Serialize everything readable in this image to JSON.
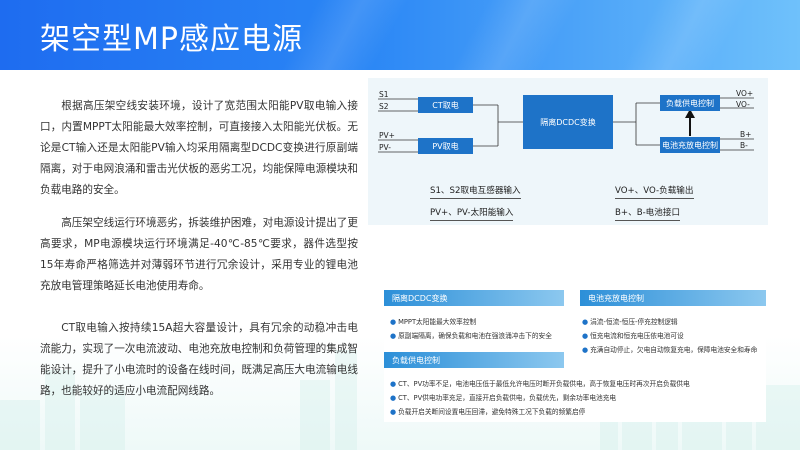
{
  "header": {
    "title": "架空型MP感应电源"
  },
  "paragraphs": [
    "根据高压架空线安装环境，设计了宽范围太阳能PV取电输入接口，内置MPPT太阳能最大效率控制，可直接接入太阳能光伏板。无论是CT输入还是太阳能PV输入均采用隔离型DCDC变换进行原副端隔离，对于电网浪涌和雷击光伏板的恶劣工况，均能保障电源模块和负载电路的安全。",
    "高压架空线运行环境恶劣，拆装维护困难，对电源设计提出了更高要求，MP电源模块运行环境满足-40℃-85℃要求，器件选型按15年寿命严格筛选并对薄弱环节进行冗余设计，采用专业的锂电池充放电管理策略延长电池使用寿命。",
    "CT取电输入按持续15A超大容量设计，具有冗余的动稳冲击电流能力，实现了一次电流波动、电池充放电控制和负荷管理的集成智能设计，提升了小电流时的设备在线时间，既满足高压大电流输电线路，也能较好的适应小电流配网线路。"
  ],
  "diagram": {
    "ports": {
      "s1": "S1",
      "s2": "S2",
      "pvp": "PV+",
      "pvm": "PV-",
      "vop": "VO+",
      "vom": "VO-",
      "bp": "B+",
      "bm": "B-"
    },
    "boxes": {
      "ct": "CT取电",
      "pv": "PV取电",
      "dcdc": "隔离DCDC变换",
      "load": "负载供电控制",
      "battery": "电池充放电控制"
    },
    "legend": {
      "s_desc": "S1、S2取电互感器输入",
      "pv_desc": "PV+、PV-太阳能输入",
      "vo_desc": "VO+、VO-负载输出",
      "b_desc": "B+、B-电池接口"
    }
  },
  "features": {
    "dcdc": {
      "title": "隔离DCDC变换",
      "items": [
        "MPPT太阳能最大效率控制",
        "原副端隔离，确保负载和电池在强浪涌冲击下的安全"
      ]
    },
    "battery": {
      "title": "电池充放电控制",
      "items": [
        "涓流-恒流-恒压-停充控制逻辑",
        "恒充电流和恒充电压依电池可设",
        "充满自动停止，欠电自动恢复充电，保障电池安全和寿命"
      ]
    },
    "load": {
      "title": "负载供电控制",
      "items": [
        "CT、PV功率不足，电池电压低于最低允许电压时断开负载供电，高于恢复电压时再次开启负载供电",
        "CT、PV供电功率充足，直接开启负载供电，负载优先，剩余功率电池充电",
        "负载开启关断间设置电压回滞，避免特殊工况下负载的频繁启停"
      ]
    }
  },
  "colors": {
    "header_start": "#1e6cf0",
    "header_end": "#6fc1fb",
    "box_blue": "#1e73c8",
    "head_blue": "#2c8fd8",
    "panel_bg": "#eef6fa"
  }
}
